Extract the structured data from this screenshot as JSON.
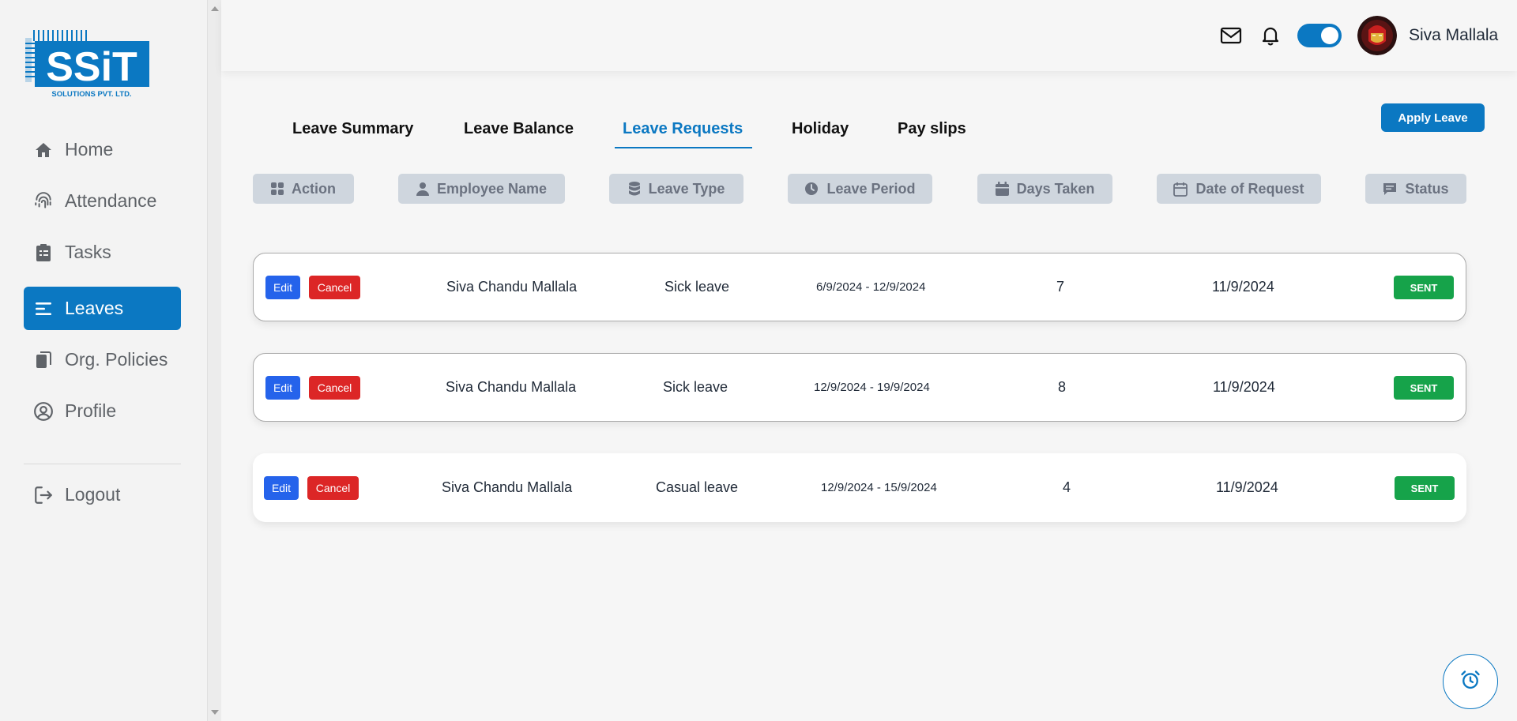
{
  "logo": {
    "text": "SSiT",
    "subtext": "SOLUTIONS PVT. LTD."
  },
  "sidebar": {
    "items": [
      {
        "label": "Home",
        "icon": "home-icon"
      },
      {
        "label": "Attendance",
        "icon": "fingerprint-icon"
      },
      {
        "label": "Tasks",
        "icon": "clipboard-icon"
      },
      {
        "label": "Leaves",
        "icon": "bars-icon",
        "active": true
      },
      {
        "label": "Org. Policies",
        "icon": "documents-icon"
      },
      {
        "label": "Profile",
        "icon": "user-circle-icon"
      }
    ],
    "logout": "Logout"
  },
  "header": {
    "username": "Siva Mallala",
    "icons": [
      "mail-icon",
      "bell-icon",
      "theme-toggle",
      "avatar"
    ]
  },
  "tabs": [
    {
      "label": "Leave Summary"
    },
    {
      "label": "Leave Balance"
    },
    {
      "label": "Leave Requests",
      "active": true
    },
    {
      "label": "Holiday"
    },
    {
      "label": "Pay slips"
    }
  ],
  "apply_button": "Apply Leave",
  "columns": [
    {
      "label": "Action",
      "icon": "grid-icon"
    },
    {
      "label": "Employee Name",
      "icon": "person-icon"
    },
    {
      "label": "Leave Type",
      "icon": "database-icon"
    },
    {
      "label": "Leave Period",
      "icon": "clock-icon"
    },
    {
      "label": "Days Taken",
      "icon": "calendar-icon"
    },
    {
      "label": "Date of Request",
      "icon": "calendar-outline-icon"
    },
    {
      "label": "Status",
      "icon": "message-icon"
    }
  ],
  "actions": {
    "edit": "Edit",
    "cancel": "Cancel"
  },
  "rows": [
    {
      "employee": "Siva Chandu Mallala",
      "leave_type": "Sick leave",
      "period": "6/9/2024 - 12/9/2024",
      "days": "7",
      "requested": "11/9/2024",
      "status": "SENT"
    },
    {
      "employee": "Siva Chandu Mallala",
      "leave_type": "Sick leave",
      "period": "12/9/2024 - 19/9/2024",
      "days": "8",
      "requested": "11/9/2024",
      "status": "SENT"
    },
    {
      "employee": "Siva Chandu Mallala",
      "leave_type": "Casual leave",
      "period": "12/9/2024 - 15/9/2024",
      "days": "4",
      "requested": "11/9/2024",
      "status": "SENT"
    }
  ],
  "colors": {
    "primary": "#0b78c2",
    "edit": "#2563eb",
    "cancel": "#dc2626",
    "status_sent": "#16a34a",
    "column_header_bg": "#cfd6de"
  },
  "fab_icon": "alarm-clock-icon"
}
